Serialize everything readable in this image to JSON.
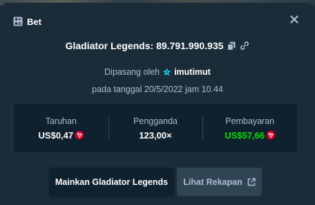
{
  "header": {
    "title": "Bet",
    "icon": "bet-slip-icon",
    "close_icon": "close-icon"
  },
  "game": {
    "name_and_id": "Gladiator Legends: 89.791.990.935",
    "copy_icon": "copy-icon",
    "link_icon": "link-icon"
  },
  "placed_by": {
    "prefix": "Dipasang oleh",
    "user_icon": "vip-badge-icon",
    "username": "imutimut"
  },
  "placed_on": {
    "text": "pada tanggal 20/5/2022 jam 10.44"
  },
  "stats": {
    "bet": {
      "label": "Taruhan",
      "value": "US$0,47",
      "currency_icon": "tron-coin-icon"
    },
    "multiplier": {
      "label": "Pengganda",
      "value": "123,00×"
    },
    "payout": {
      "label": "Pembayaran",
      "value": "US$57,66",
      "currency_icon": "tron-coin-icon"
    }
  },
  "buttons": {
    "play_label": "Mainkan Gladiator Legends",
    "replay_label": "Lihat Rekapan",
    "external_icon": "external-link-icon"
  },
  "colors": {
    "background": "#1a2c38",
    "panel": "#0f212e",
    "muted_text": "#b1bad3",
    "payout_green": "#00e701",
    "coin_red": "#eb0029",
    "badge_cyan": "#1bcbe7"
  }
}
